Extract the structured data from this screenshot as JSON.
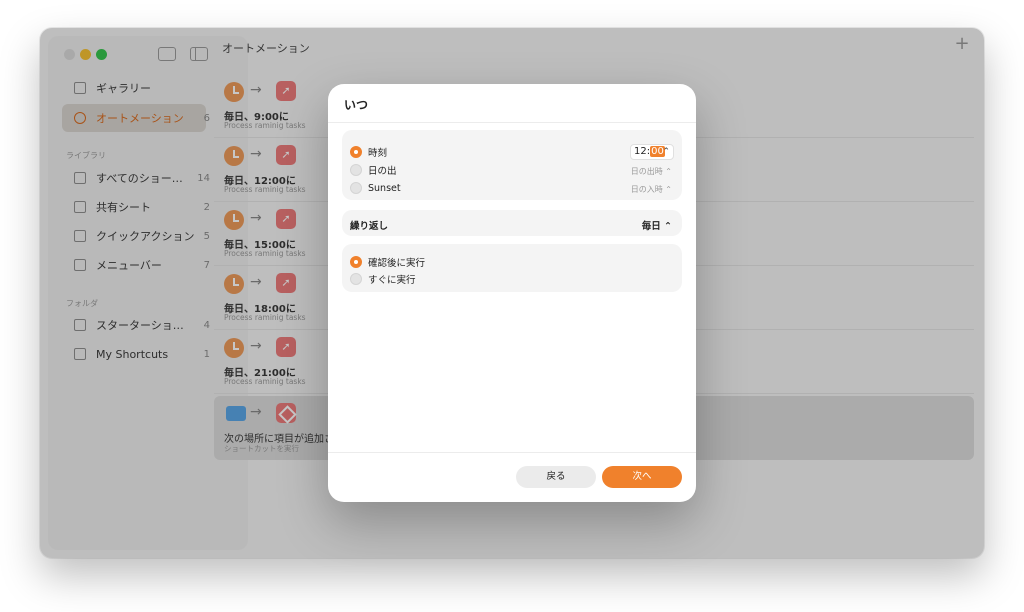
{
  "window": {
    "title": "オートメーション"
  },
  "sidebar": {
    "items": [
      {
        "label": "ギャラリー",
        "count": ""
      },
      {
        "label": "オートメーション",
        "count": "6"
      }
    ],
    "library_label": "ライブラリ",
    "library": [
      {
        "label": "すべてのショー…",
        "count": "14"
      },
      {
        "label": "共有シート",
        "count": "2"
      },
      {
        "label": "クイックアクション",
        "count": "5"
      },
      {
        "label": "メニューバー",
        "count": "7"
      }
    ],
    "folders_label": "フォルダ",
    "folders": [
      {
        "label": "スターターショ…",
        "count": "4"
      },
      {
        "label": "My Shortcuts",
        "count": "1"
      }
    ]
  },
  "automations": [
    {
      "title": "毎日、9:00に",
      "subtitle": "Process raminig tasks"
    },
    {
      "title": "毎日、12:00に",
      "subtitle": "Process raminig tasks"
    },
    {
      "title": "毎日、15:00に",
      "subtitle": "Process raminig tasks"
    },
    {
      "title": "毎日、18:00に",
      "subtitle": "Process raminig tasks"
    },
    {
      "title": "毎日、21:00に",
      "subtitle": "Process raminig tasks"
    },
    {
      "title": "次の場所に項目が追加され",
      "subtitle": "ショートカットを実行"
    }
  ],
  "dialog": {
    "title": "いつ",
    "when_options": [
      {
        "label": "時刻",
        "selected": true
      },
      {
        "label": "日の出",
        "value": "日の出時 ⌃"
      },
      {
        "label": "Sunset",
        "value": "日の入時 ⌃"
      }
    ],
    "time_hour": "12:",
    "time_minute": "00",
    "stepper_glyph": "⌃",
    "repeat_label": "繰り返し",
    "repeat_value": "毎日 ⌃",
    "run_options": [
      {
        "label": "確認後に実行",
        "selected": true
      },
      {
        "label": "すぐに実行",
        "selected": false
      }
    ],
    "back_label": "戻る",
    "next_label": "次へ"
  },
  "colors": {
    "accent": "#f0812c",
    "selection": "#d96b1f"
  }
}
